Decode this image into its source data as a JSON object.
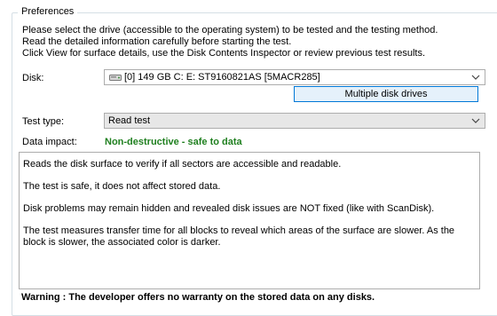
{
  "preferences": {
    "title": "Preferences",
    "intro_lines": [
      "Please select the drive (accessible to the operating system) to be tested and the testing method.",
      "Read the detailed information carefully before starting the test.",
      "Click View for surface details, use the Disk Contents Inspector or review previous test results."
    ]
  },
  "disk": {
    "label": "Disk:",
    "selected": "[0]   149 GB   C: E:   ST9160821AS [5MACR285]",
    "multiple_button": "Multiple disk drives"
  },
  "test_type": {
    "label": "Test type:",
    "selected": "Read test"
  },
  "data_impact": {
    "label": "Data impact:",
    "value": "Non-destructive - safe to data",
    "color": "#208020"
  },
  "description": [
    "Reads the disk surface to verify if all sectors are accessible and readable.",
    "The test is safe, it does not affect stored data.",
    "Disk problems may remain hidden and revealed disk issues are NOT fixed (like with ScanDisk).",
    "The test measures transfer time for all blocks to reveal which areas of the surface are slower. As the block is slower, the associated color is darker."
  ],
  "warning": "Warning : The developer offers no warranty on the stored data on any disks.",
  "icons": {
    "disk": "hard-disk-icon",
    "dropdown": "chevron-down-icon"
  }
}
